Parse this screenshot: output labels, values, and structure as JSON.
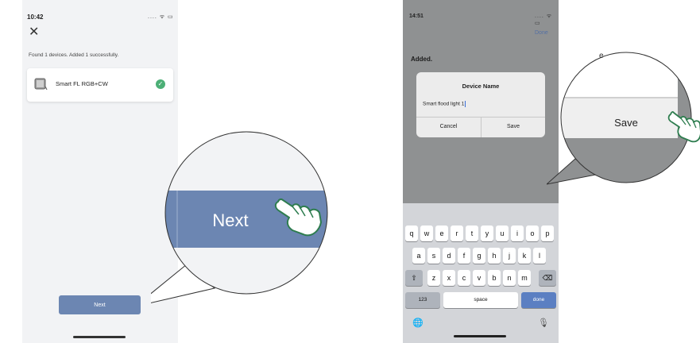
{
  "left_screen": {
    "status_time": "10:42",
    "status_icons": ".... ᯤ ▭",
    "close_glyph": "✕",
    "found_text": "Found 1 devices. Added 1 successfully.",
    "device_name": "Smart FL RGB+CW",
    "check_glyph": "✓",
    "next_label": "Next",
    "zoom_label": "Next"
  },
  "right_screen": {
    "status_time": "14:51",
    "status_icons": ".... ᯤ ▭",
    "done_label": "Done",
    "added_label": "Added.",
    "dialog_title": "Device Name",
    "input_value": "Smart flood light 1",
    "cancel_label": "Cancel",
    "save_label": "Save",
    "zoom_save_label": "Save",
    "zoom_partial_letter": "e",
    "keyboard": {
      "row1": [
        "q",
        "w",
        "e",
        "r",
        "t",
        "y",
        "u",
        "i",
        "o",
        "p"
      ],
      "row2": [
        "a",
        "s",
        "d",
        "f",
        "g",
        "h",
        "j",
        "k",
        "l"
      ],
      "row3": [
        "z",
        "x",
        "c",
        "v",
        "b",
        "n",
        "m"
      ],
      "shift": "⇧",
      "backspace": "⌫",
      "numbers": "123",
      "space": "space",
      "done": "done",
      "globe": "🌐",
      "mic": "🎙"
    }
  },
  "colors": {
    "accent_blue": "#6c86b2",
    "success_green": "#4caf76",
    "dim_overlay": "#8f9192",
    "keyboard_bg": "#d3d5d9"
  }
}
